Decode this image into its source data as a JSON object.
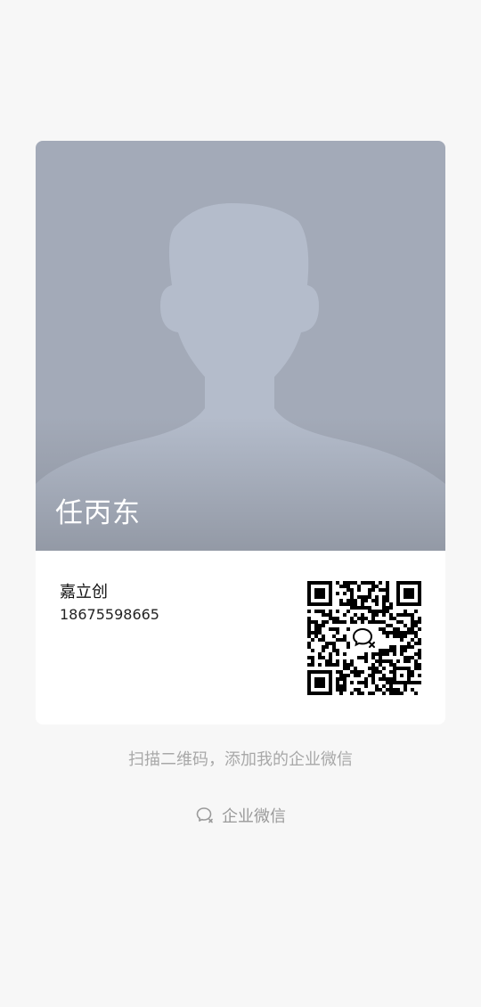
{
  "card": {
    "name": "任丙东",
    "company": "嘉立创",
    "phone": "18675598665"
  },
  "qr_code": {
    "center_icon": "wecom-logo-icon"
  },
  "footer": {
    "hint": "扫描二维码，添加我的企业微信",
    "brand_label": "企业微信",
    "brand_icon": "wecom-logo-icon"
  },
  "colors": {
    "background": "#f7f7f7",
    "photo_bg": "#a3aab8",
    "silhouette": "#b4bccb",
    "hint_text": "#a8a8a8"
  }
}
